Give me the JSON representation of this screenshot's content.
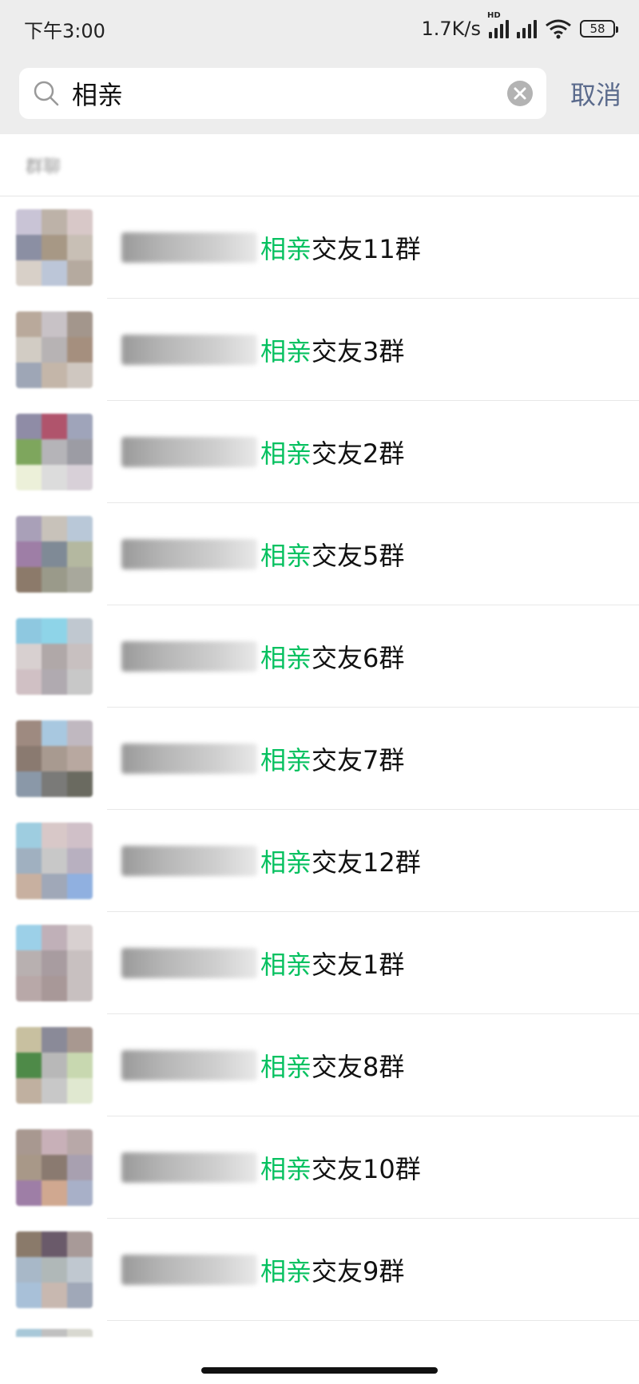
{
  "status_bar": {
    "time": "下午3:00",
    "speed": "1.7K/s",
    "hd": "HD",
    "battery": "58"
  },
  "search": {
    "query": "相亲",
    "cancel_label": "取消"
  },
  "section": {
    "title": "群聊"
  },
  "highlight": "相亲",
  "results": [
    {
      "suffix": "交友11群",
      "colors": [
        "#c9c4d6",
        "#bdb2a8",
        "#d8c8c8",
        "#8b8fa3",
        "#a79885",
        "#c8bfb5",
        "#d8d0c8",
        "#bcc6d8",
        "#b5aa9f"
      ]
    },
    {
      "suffix": "交友3群",
      "colors": [
        "#b9a99b",
        "#c8c2c6",
        "#a3968c",
        "#d2ccc4",
        "#b7b3b4",
        "#a58f7e",
        "#9ea6b6",
        "#c4b6a9",
        "#cfc7c0"
      ]
    },
    {
      "suffix": "交友2群",
      "colors": [
        "#8f8ca6",
        "#b0546c",
        "#9fa4ba",
        "#7ea65d",
        "#b5b4b8",
        "#9c9ca4",
        "#ecf0d9",
        "#dcdcdc",
        "#d8d0d8"
      ]
    },
    {
      "suffix": "交友5群",
      "colors": [
        "#a9a0b8",
        "#c8c2ba",
        "#b9c8d8",
        "#9e7ea6",
        "#7f8a96",
        "#b4b8a0",
        "#8c7a6a",
        "#9a9a8a",
        "#a8a89c"
      ]
    },
    {
      "suffix": "交友6群",
      "colors": [
        "#8ec8e0",
        "#8ed4e8",
        "#c0c8d0",
        "#d8d0d0",
        "#b0a8a8",
        "#c8c0c0",
        "#d0c0c4",
        "#b0aab0",
        "#c8c8c8"
      ]
    },
    {
      "suffix": "交友7群",
      "colors": [
        "#9e8a80",
        "#a8c8e0",
        "#c0b8c0",
        "#8a7a70",
        "#a89a90",
        "#b8a8a0",
        "#8a98a8",
        "#7a7a78",
        "#6a6a60"
      ]
    },
    {
      "suffix": "交友12群",
      "colors": [
        "#9ecde0",
        "#d8c8c8",
        "#d0c0c8",
        "#a0b0c0",
        "#c8c8c8",
        "#b8b0c0",
        "#c8b0a0",
        "#a0a8b8",
        "#90b0e0"
      ]
    },
    {
      "suffix": "交友1群",
      "colors": [
        "#9cd0e8",
        "#c0b0b8",
        "#d8d0d0",
        "#b8b0b0",
        "#a89ca0",
        "#c8c0c0",
        "#b8a8a8",
        "#a89898",
        "#c8c0c0"
      ]
    },
    {
      "suffix": "交友8群",
      "colors": [
        "#c8c0a0",
        "#8a8a98",
        "#a89890",
        "#4e8a48",
        "#b8b8b8",
        "#c8d8b0",
        "#c0b0a0",
        "#c8c8c8",
        "#e0e8d0"
      ]
    },
    {
      "suffix": "交友10群",
      "colors": [
        "#a89890",
        "#c8b0b8",
        "#b8a8a8",
        "#a89888",
        "#8a7a70",
        "#a8a0b0",
        "#9e7ea6",
        "#d0a890",
        "#a8b0c8"
      ]
    },
    {
      "suffix": "交友9群",
      "colors": [
        "#8a7a6a",
        "#6a5a6a",
        "#a89a98",
        "#a8b8c8",
        "#b0b8b8",
        "#c0c8d0",
        "#a8c0d8",
        "#c8b8b0",
        "#a0a8b8"
      ]
    }
  ],
  "peek_colors": [
    "#a8c8d8",
    "#c0c0c0",
    "#d8d8d0"
  ]
}
